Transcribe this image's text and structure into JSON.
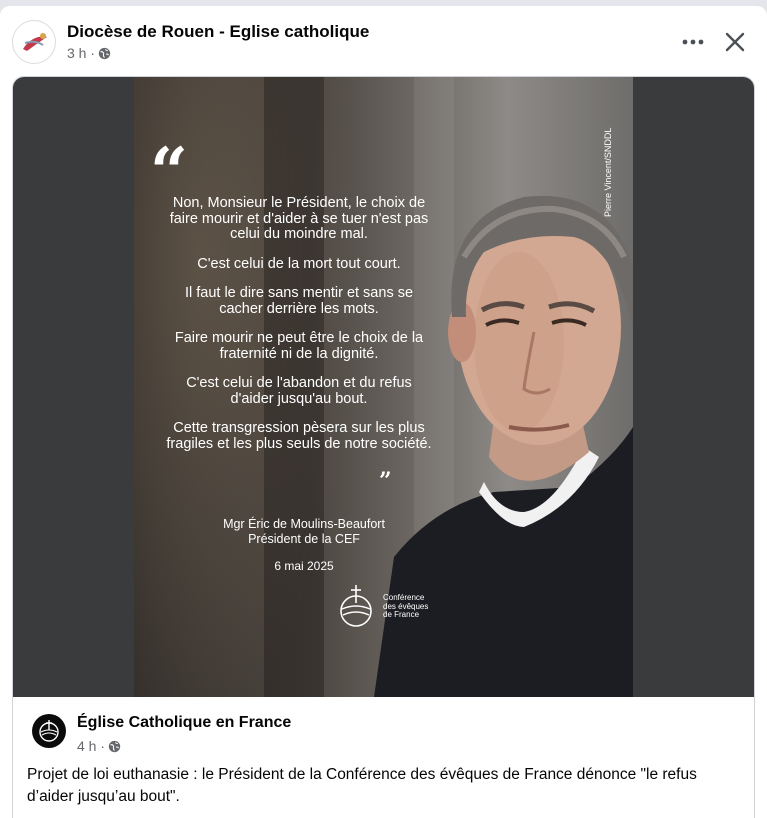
{
  "post": {
    "page_name": "Diocèse de Rouen - Eglise catholique",
    "time": "3 h ·"
  },
  "image": {
    "credit": "Pierre Vincent/SNDDL",
    "quote_paragraphs": [
      "Non, Monsieur le Président, le choix de faire mourir et d'aider à se tuer n'est pas celui du moindre mal.",
      "C'est celui de la mort tout court.",
      "Il faut le dire sans mentir et sans se cacher derrière les mots.",
      "Faire mourir ne peut être le choix de la fraternité ni de la dignité.",
      "C'est celui de l'abandon et du refus d'aider jusqu'au bout.",
      "Cette transgression pèsera sur les plus fragiles et les plus seuls de notre société."
    ],
    "author_line1": "Mgr Éric de Moulins-Beaufort",
    "author_line2": "Président de la CEF",
    "date": "6 mai 2025",
    "logo_text": "Conférence\ndes évêques\nde France"
  },
  "shared": {
    "page_name": "Église Catholique en France",
    "time": "4 h ·",
    "caption": "Projet de loi euthanasie : le Président de la Conférence des évêques de France dénonce \"le refus d’aider jusqu’au bout\"."
  }
}
